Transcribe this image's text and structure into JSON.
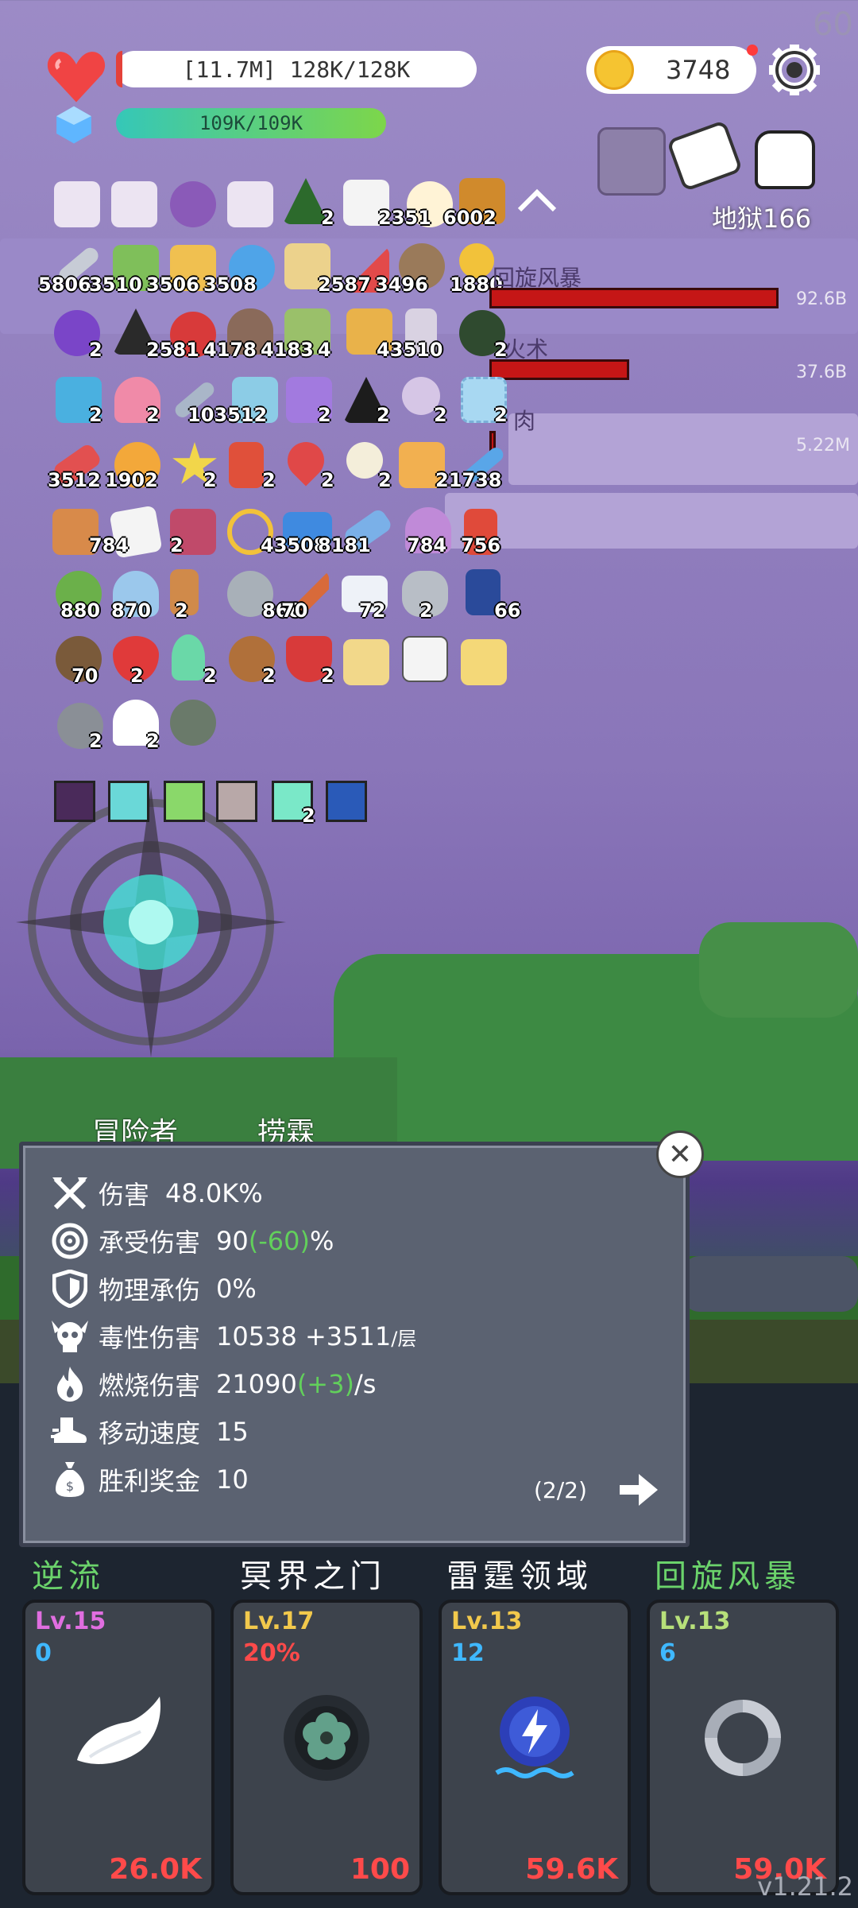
{
  "fps": "60",
  "hp": {
    "text": "[11.7M] 128K/128K"
  },
  "mana": {
    "text": "109K/109K"
  },
  "gold": "3748",
  "level_label": "地狱166",
  "damage_meter": [
    {
      "name": "回旋风暴",
      "value": "92.6B"
    },
    {
      "name": "火术",
      "value": "37.6B"
    },
    {
      "name": "肉",
      "value": "5.22M"
    }
  ],
  "inventory_counts": [
    "2",
    "2351",
    "6002",
    "5806",
    "3510",
    "3506",
    "3508",
    "2587",
    "3496",
    "1880",
    "2",
    "2581",
    "4178",
    "4183",
    "4",
    "43510",
    "2",
    "2",
    "2",
    "103512",
    "2",
    "2",
    "2",
    "3512",
    "1902",
    "2",
    "2",
    "2",
    "2",
    "21738",
    "2",
    "784",
    "2",
    "43508",
    "8181",
    "784",
    "756",
    "880",
    "870",
    "2",
    "868",
    "70",
    "72",
    "2",
    "66",
    "70",
    "2",
    "2",
    "2",
    "2",
    "2",
    "2"
  ],
  "skill_row_count": "2",
  "tabs": {
    "adventurer": "冒险者",
    "other": "捞霖"
  },
  "stats": [
    {
      "icon": "crossed-axes-icon",
      "label": "伤害",
      "value": "48.0K%",
      "extra": "",
      "unit": ""
    },
    {
      "icon": "target-icon",
      "label": "承受伤害",
      "value": "90",
      "extra": "(-60)",
      "unit": "%"
    },
    {
      "icon": "shield-icon",
      "label": "物理承伤",
      "value": "0%",
      "extra": "",
      "unit": ""
    },
    {
      "icon": "skull-icon",
      "label": "毒性伤害",
      "value": "10538  +3511",
      "extra": "",
      "unit": "/层"
    },
    {
      "icon": "fire-icon",
      "label": "燃烧伤害",
      "value": "21090",
      "extra": "(+3)",
      "unit": "/s"
    },
    {
      "icon": "boot-icon",
      "label": "移动速度",
      "value": "15",
      "extra": "",
      "unit": ""
    },
    {
      "icon": "money-bag-icon",
      "label": "胜利奖金",
      "value": "10",
      "extra": "",
      "unit": ""
    }
  ],
  "stats_page": "(2/2)",
  "skills": [
    {
      "name": "逆流",
      "name_color": "#6bd36b",
      "level": "Lv.15",
      "level_color": "#e06ee0",
      "sub": "0",
      "sub_color": "#3fb8ff",
      "cost": "26.0K",
      "art": "wing-icon"
    },
    {
      "name": "冥界之门",
      "name_color": "#ffffff",
      "level": "Lv.17",
      "level_color": "#f2c94c",
      "sub": "20%",
      "sub_color": "#ff4a4a",
      "cost": "100",
      "art": "portal-flower-icon"
    },
    {
      "name": "雷霆领域",
      "name_color": "#ffffff",
      "level": "Lv.13",
      "level_color": "#f2c94c",
      "sub": "12",
      "sub_color": "#3fb8ff",
      "cost": "59.6K",
      "art": "thunder-gear-icon"
    },
    {
      "name": "回旋风暴",
      "name_color": "#6bd36b",
      "level": "Lv.13",
      "level_color": "#b7e07a",
      "sub": "6",
      "sub_color": "#3fb8ff",
      "cost": "59.0K",
      "art": "whirlwind-icon"
    }
  ],
  "version": "v1.21.2"
}
